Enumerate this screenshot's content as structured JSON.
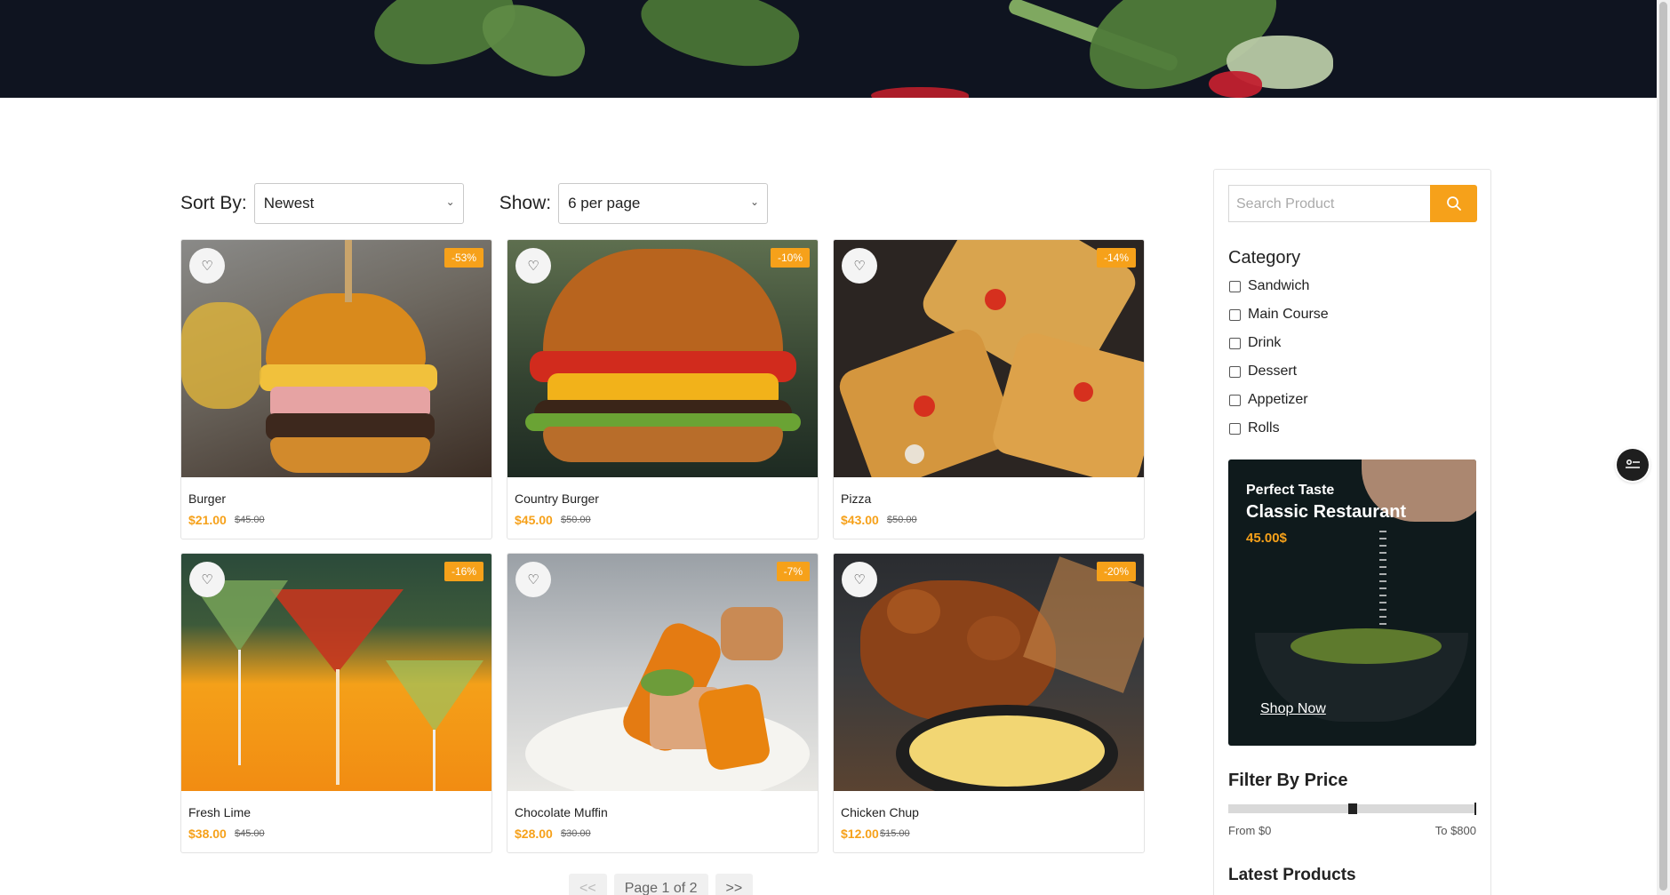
{
  "toolbar": {
    "sort_label": "Sort By:",
    "sort_value": "Newest",
    "show_label": "Show:",
    "show_value": "6 per page"
  },
  "products": [
    {
      "name": "Burger",
      "price": "$21.00",
      "old_price": "$45.00",
      "discount": "-53%"
    },
    {
      "name": "Country Burger",
      "price": "$45.00",
      "old_price": "$50.00",
      "discount": "-10%"
    },
    {
      "name": "Pizza",
      "price": "$43.00",
      "old_price": "$50.00",
      "discount": "-14%"
    },
    {
      "name": "Fresh Lime",
      "price": "$38.00",
      "old_price": "$45.00",
      "discount": "-16%"
    },
    {
      "name": "Chocolate Muffin",
      "price": "$28.00",
      "old_price": "$30.00",
      "discount": "-7%"
    },
    {
      "name": "Chicken Chup",
      "price": "$12.00",
      "old_price": "$15.00",
      "discount": "-20%"
    }
  ],
  "pagination": {
    "prev": "<<",
    "current": "Page 1 of 2",
    "next": ">>"
  },
  "sidebar": {
    "search_placeholder": "Search Product",
    "category_title": "Category",
    "categories": [
      "Sandwich",
      "Main Course",
      "Drink",
      "Dessert",
      "Appetizer",
      "Rolls"
    ],
    "promo": {
      "subtitle": "Perfect Taste",
      "title": "Classic Restaurant",
      "price": "45.00$",
      "cta": "Shop Now"
    },
    "price_filter_title": "Filter By Price",
    "price_from": "From $0",
    "price_to": "To $800",
    "price_range_handle_fraction": 0.5,
    "latest_title": "Latest Products"
  },
  "colors": {
    "accent": "#f6a11a",
    "hero_bg": "#0f1420"
  }
}
